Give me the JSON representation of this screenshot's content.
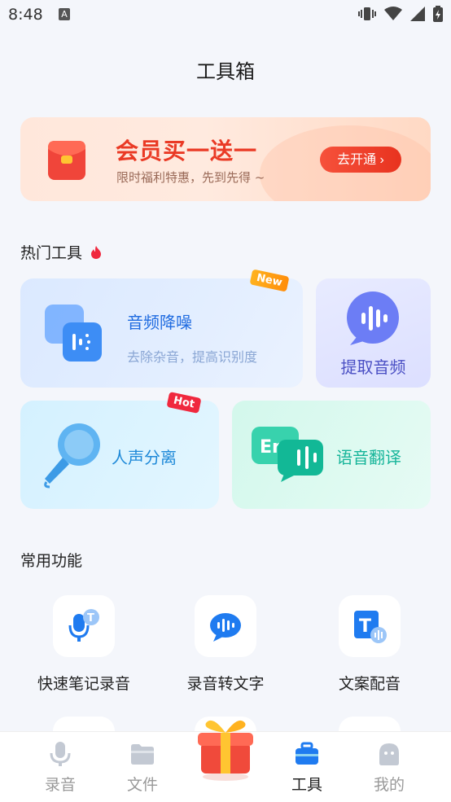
{
  "status_bar": {
    "time": "8:48",
    "notif": "A"
  },
  "header": {
    "title": "工具箱"
  },
  "banner": {
    "title": "会员买一送一",
    "subtitle": "限时福利特惠，先到先得 ~",
    "button": "去开通 ›"
  },
  "hot_tools": {
    "heading": "热门工具",
    "cards": [
      {
        "title": "音频降噪",
        "subtitle": "去除杂音，提高识别度",
        "tag": "New"
      },
      {
        "title": "提取音频"
      },
      {
        "title": "人声分离",
        "tag": "Hot"
      },
      {
        "title": "语音翻译"
      }
    ]
  },
  "common": {
    "heading": "常用功能",
    "items": [
      {
        "label": "快速笔记录音",
        "icon": "mic-t-icon"
      },
      {
        "label": "录音转文字",
        "icon": "speech-bubble-icon"
      },
      {
        "label": "文案配音",
        "icon": "text-voice-icon"
      }
    ]
  },
  "nav": {
    "items": [
      {
        "label": "录音",
        "icon": "mic-icon"
      },
      {
        "label": "文件",
        "icon": "folder-icon"
      },
      {
        "label": "",
        "icon": "gift-icon"
      },
      {
        "label": "工具",
        "icon": "toolbox-icon"
      },
      {
        "label": "我的",
        "icon": "profile-icon"
      }
    ],
    "active": "工具"
  },
  "colors": {
    "accent": "#1f7bf0",
    "banner_red": "#ea3a25",
    "teal": "#17b59a"
  }
}
